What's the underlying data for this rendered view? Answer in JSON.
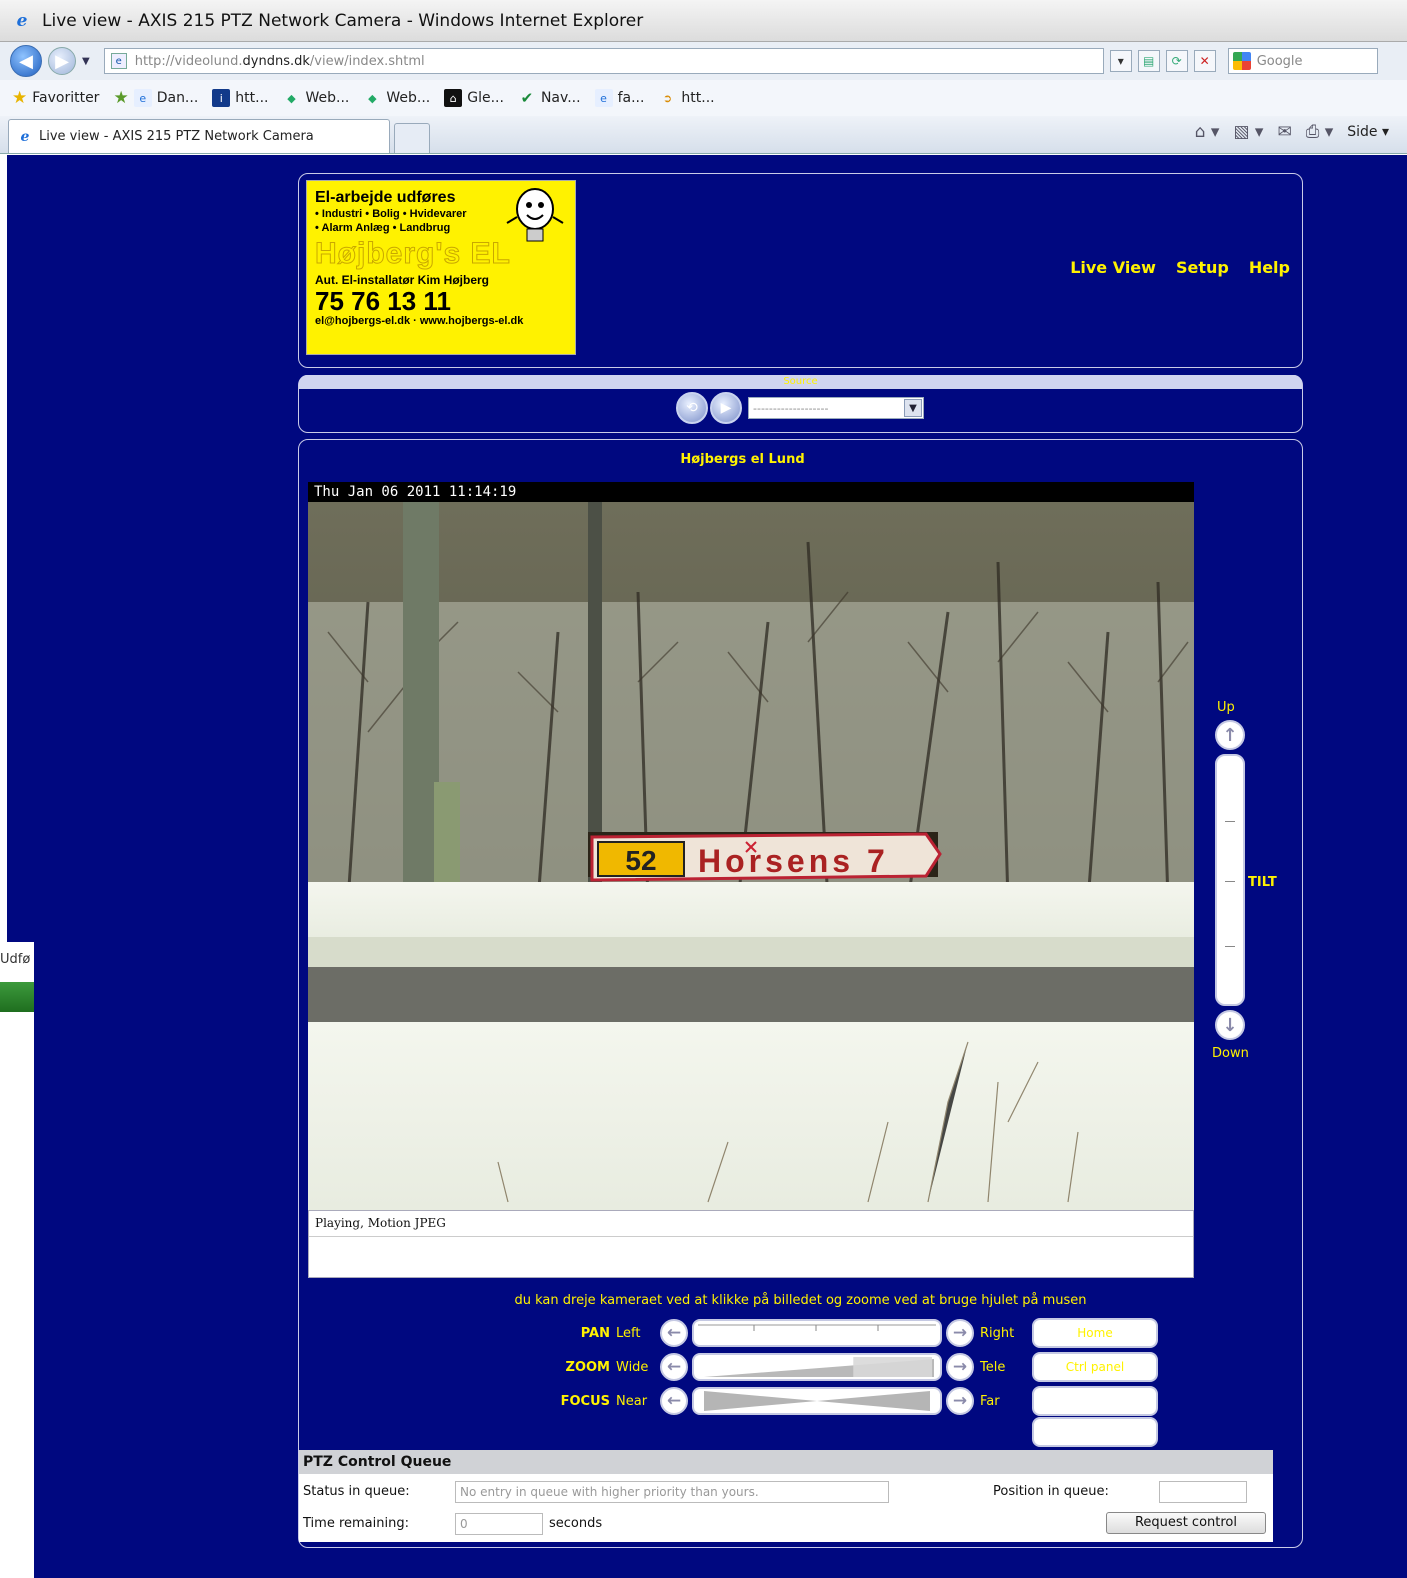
{
  "window": {
    "title": "Live view - AXIS 215 PTZ Network Camera - Windows Internet Explorer"
  },
  "address": {
    "url_prefix": "http://videolund.",
    "url_domain": "dyndns.dk",
    "url_path": "/view/index.shtml",
    "search_placeholder": "Google"
  },
  "favorites": {
    "label": "Favoritter",
    "items": [
      "Dan...",
      "htt...",
      "Web...",
      "Web...",
      "Gle...",
      "Nav...",
      "fa...",
      "htt..."
    ]
  },
  "tabs": [
    {
      "label": "Live view - AXIS 215 PTZ Network Camera"
    }
  ],
  "commandbar": {
    "page_label": "Side"
  },
  "logo": {
    "line1": "El-arbejde udføres",
    "line2": "• Industri • Bolig • Hvidevarer",
    "line3": "• Alarm Anlæg • Landbrug",
    "brand": "Højberg's EL",
    "installer": "Aut. El-installatør Kim Højberg",
    "phone": "75 76 13 11",
    "contact": "el@hojbergs-el.dk · www.hojbergs-el.dk"
  },
  "nav": {
    "live_view": "Live View",
    "setup": "Setup",
    "help": "Help"
  },
  "source": {
    "label": "Source",
    "selected": "-------------------"
  },
  "camera": {
    "title": "Højbergs el Lund",
    "timestamp": "Thu Jan 06 2011 11:14:19",
    "status": "Playing, Motion JPEG",
    "sign_number": "52",
    "sign_text": "Horsens 7"
  },
  "tilt": {
    "up": "Up",
    "down": "Down",
    "label": "TILT"
  },
  "hint": "du kan dreje kameraet ved at klikke på billedet og zoome ved at bruge hjulet på musen",
  "ptz": {
    "pan": {
      "key": "PAN",
      "min": "Left",
      "max": "Right"
    },
    "zoom": {
      "key": "ZOOM",
      "min": "Wide",
      "max": "Tele",
      "level_percent": 32
    },
    "focus": {
      "key": "FOCUS",
      "min": "Near",
      "max": "Far"
    },
    "buttons": [
      "Home",
      "Ctrl panel",
      "",
      ""
    ]
  },
  "queue": {
    "title": "PTZ Control Queue",
    "status_label": "Status in queue:",
    "status_value": "No entry in queue with higher priority than yours.",
    "position_label": "Position in queue:",
    "position_value": "",
    "time_label": "Time remaining:",
    "time_value": "0",
    "seconds": "seconds",
    "request_btn": "Request control"
  },
  "taskbar_stub": "Udfø"
}
